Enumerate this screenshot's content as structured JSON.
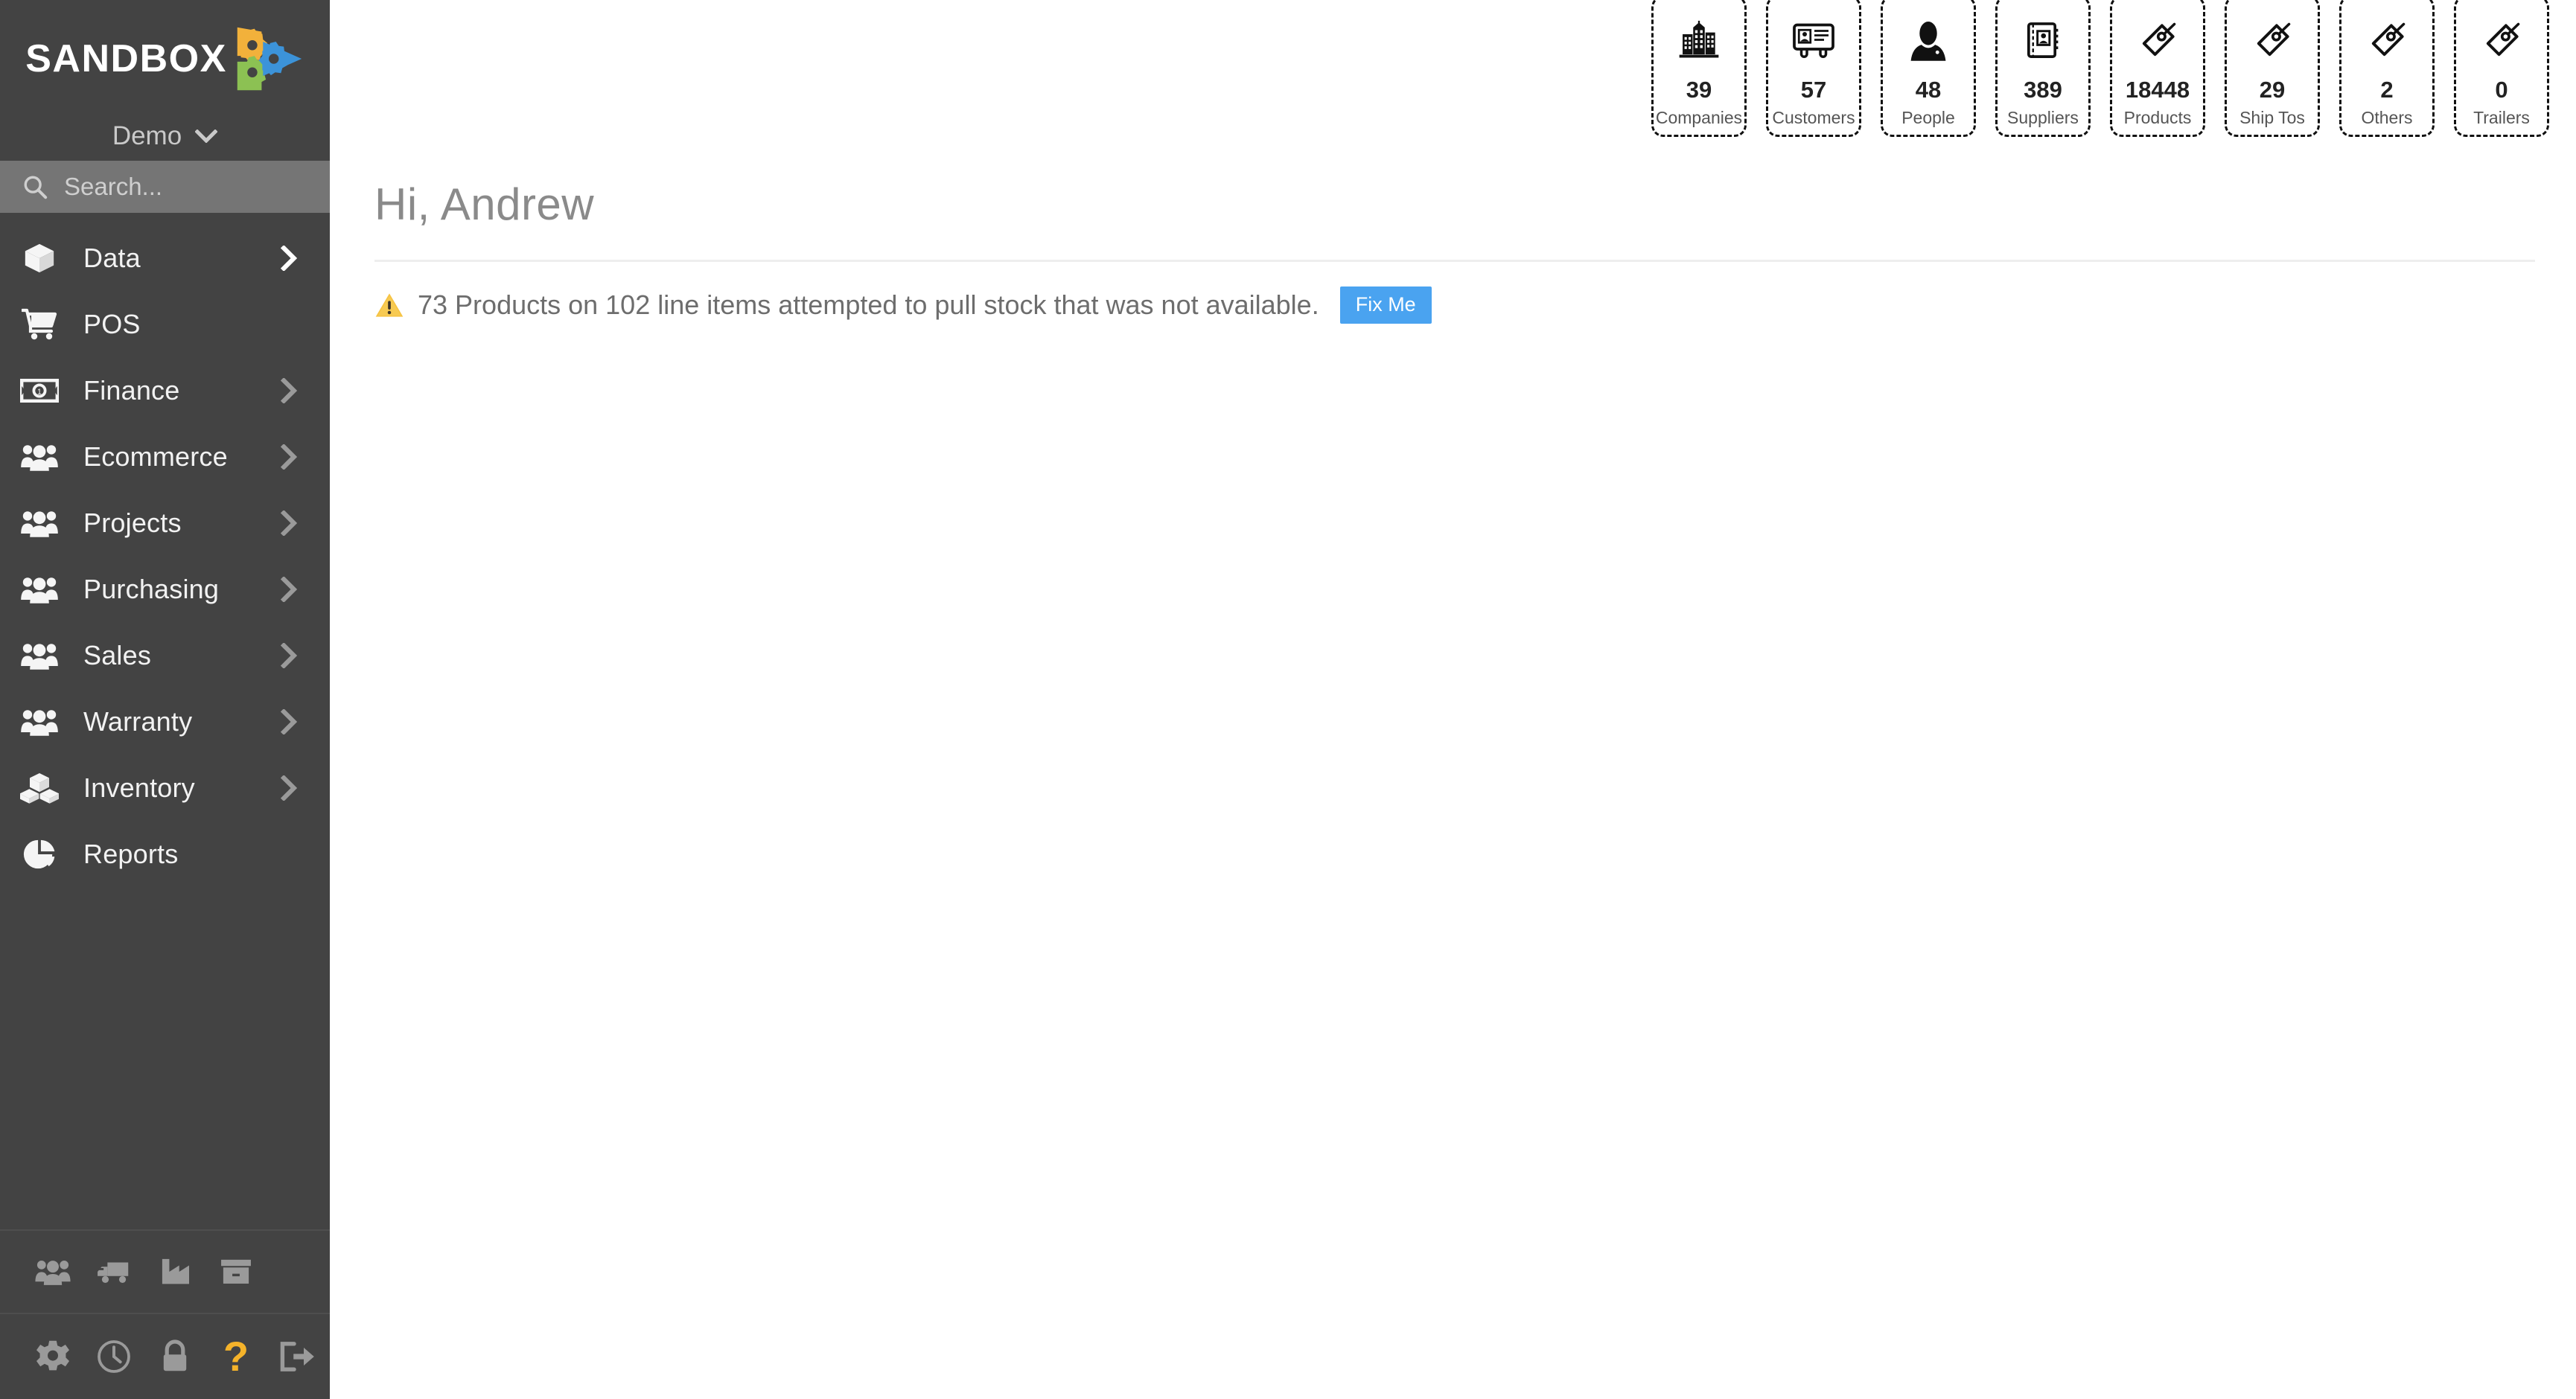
{
  "sidebar": {
    "brand": {
      "name": "SANDBOX",
      "logo_icon": "sandbox-gears-play-logo"
    },
    "org": {
      "label": "Demo",
      "chevron_icon": "chevron-down-icon"
    },
    "search": {
      "placeholder": "Search...",
      "value": "",
      "icon": "search-icon"
    },
    "nav": [
      {
        "label": "Data",
        "icon": "cube-icon",
        "has_chevron": true,
        "active": true
      },
      {
        "label": "POS",
        "icon": "shopping-cart-icon",
        "has_chevron": false,
        "active": false
      },
      {
        "label": "Finance",
        "icon": "banknote-icon",
        "has_chevron": true,
        "active": false
      },
      {
        "label": "Ecommerce",
        "icon": "users-icon",
        "has_chevron": true,
        "active": false
      },
      {
        "label": "Projects",
        "icon": "users-icon",
        "has_chevron": true,
        "active": false
      },
      {
        "label": "Purchasing",
        "icon": "users-icon",
        "has_chevron": true,
        "active": false
      },
      {
        "label": "Sales",
        "icon": "users-icon",
        "has_chevron": true,
        "active": false
      },
      {
        "label": "Warranty",
        "icon": "users-icon",
        "has_chevron": true,
        "active": false
      },
      {
        "label": "Inventory",
        "icon": "boxes-icon",
        "has_chevron": true,
        "active": false
      },
      {
        "label": "Reports",
        "icon": "pie-chart-icon",
        "has_chevron": false,
        "active": false
      }
    ],
    "footer_top_icons": [
      {
        "icon": "users-icon"
      },
      {
        "icon": "delivery-truck-icon"
      },
      {
        "icon": "factory-icon"
      },
      {
        "icon": "archive-box-icon"
      }
    ],
    "footer_bottom_icons": [
      {
        "icon": "gear-icon"
      },
      {
        "icon": "clock-icon"
      },
      {
        "icon": "lock-icon"
      },
      {
        "icon": "question-mark-icon",
        "glyph": "?"
      },
      {
        "icon": "logout-icon"
      }
    ]
  },
  "stats": [
    {
      "value": "39",
      "label": "Companies",
      "icon": "city-buildings-icon"
    },
    {
      "value": "57",
      "label": "Customers",
      "icon": "id-card-icon"
    },
    {
      "value": "48",
      "label": "People",
      "icon": "person-avatar-icon"
    },
    {
      "value": "389",
      "label": "Suppliers",
      "icon": "address-book-icon"
    },
    {
      "value": "18448",
      "label": "Products",
      "icon": "tag-icon"
    },
    {
      "value": "29",
      "label": "Ship Tos",
      "icon": "tag-icon"
    },
    {
      "value": "2",
      "label": "Others",
      "icon": "tag-icon"
    },
    {
      "value": "0",
      "label": "Trailers",
      "icon": "tag-icon"
    }
  ],
  "main": {
    "greeting": "Hi, Andrew",
    "alert": {
      "icon": "warning-triangle-icon",
      "message": "73 Products on 102 line items attempted to pull stock that was not available.",
      "action_label": "Fix Me"
    }
  },
  "colors": {
    "sidebar_bg": "#434343",
    "search_bg": "#757575",
    "accent_blue": "#4aa3f0",
    "warning_yellow": "#f5b32a",
    "logo_yellow": "#f2b13b",
    "logo_blue": "#3c93d9",
    "logo_green": "#8cc153",
    "page_bg": "#ffffff"
  }
}
